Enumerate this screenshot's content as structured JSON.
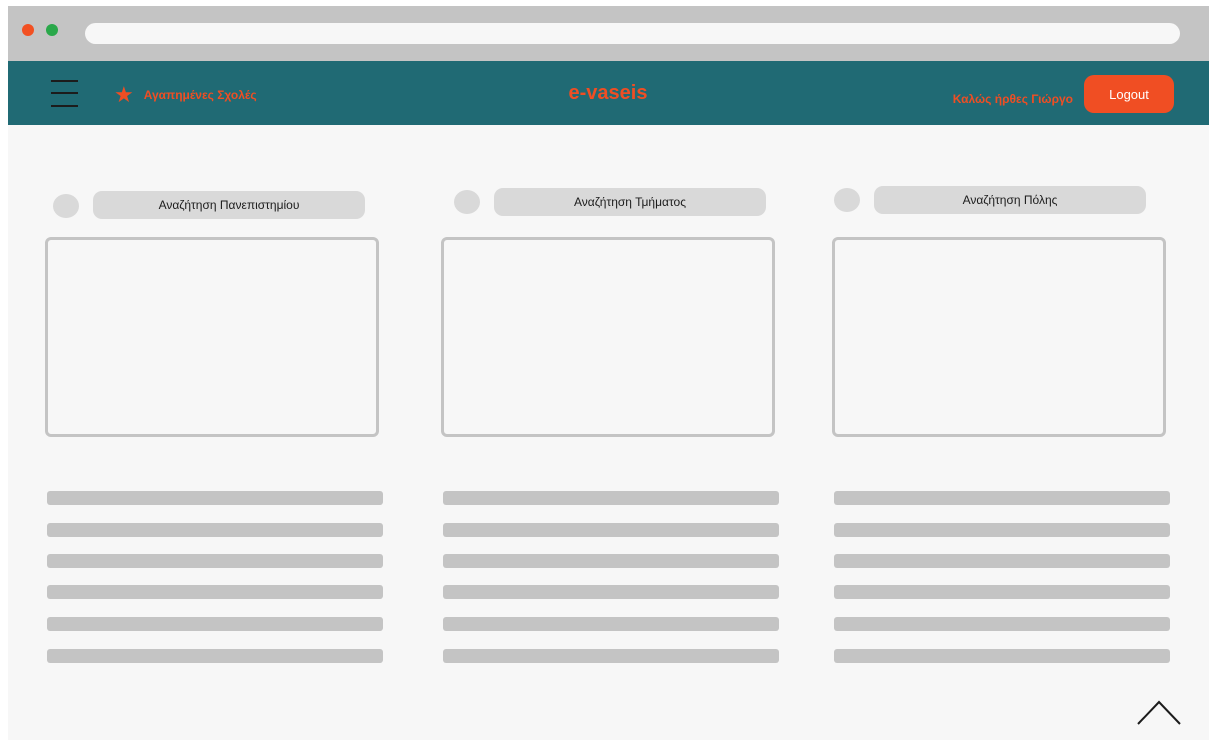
{
  "navbar": {
    "favorites_icon": "star-icon",
    "favorites_label": "Αγαπημένες Σχολές",
    "brand": "e-vaseis",
    "welcome": "Καλώς ήρθες Γιώργο",
    "logout_label": "Logout"
  },
  "columns": [
    {
      "search_label": "Αναζήτηση Πανεπιστημίου"
    },
    {
      "search_label": "Αναζήτηση Τμήματος"
    },
    {
      "search_label": "Αναζήτηση Πόλης"
    }
  ],
  "scroll_top_icon": "chevron-up-icon",
  "colors": {
    "navbar": "#206a74",
    "accent": "#f04e23",
    "chrome": "#c4c4c4",
    "background": "#f7f7f7",
    "placeholder": "#d9d9d9"
  }
}
